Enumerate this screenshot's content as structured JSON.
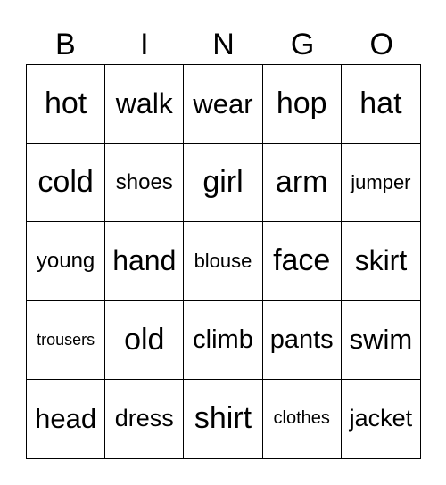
{
  "header": [
    "B",
    "I",
    "N",
    "G",
    "O"
  ],
  "cells": [
    [
      "hot",
      "walk",
      "wear",
      "hop",
      "hat"
    ],
    [
      "cold",
      "shoes",
      "girl",
      "arm",
      "jumper"
    ],
    [
      "young",
      "hand",
      "blouse",
      "face",
      "skirt"
    ],
    [
      "trousers",
      "old",
      "climb",
      "pants",
      "swim"
    ],
    [
      "head",
      "dress",
      "shirt",
      "clothes",
      "jacket"
    ]
  ]
}
